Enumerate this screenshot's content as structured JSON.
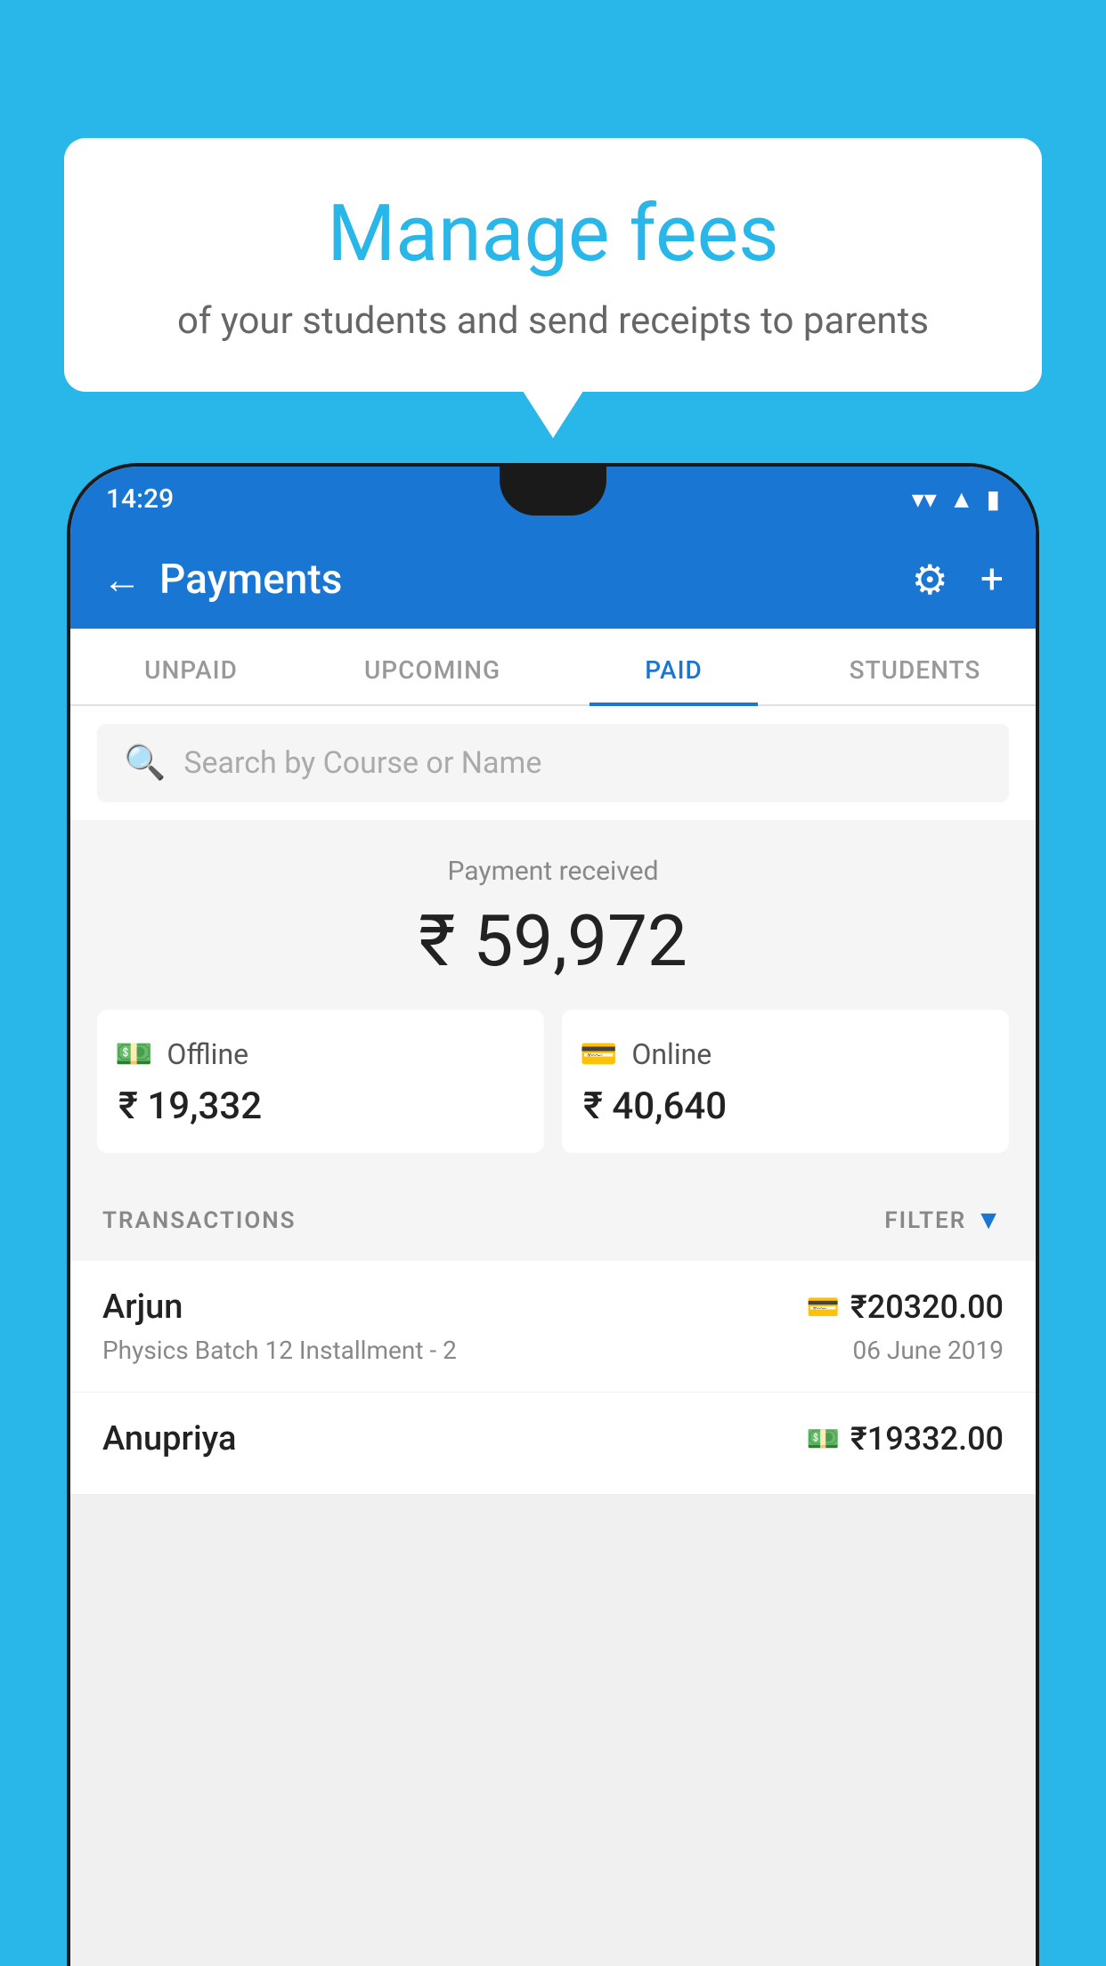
{
  "background_color": "#29B6E8",
  "speech_bubble": {
    "title": "Manage fees",
    "subtitle": "of your students and send receipts to parents"
  },
  "status_bar": {
    "time": "14:29"
  },
  "app_bar": {
    "title": "Payments",
    "back_label": "←",
    "gear_label": "⚙",
    "plus_label": "+"
  },
  "tabs": [
    {
      "label": "UNPAID",
      "active": false
    },
    {
      "label": "UPCOMING",
      "active": false
    },
    {
      "label": "PAID",
      "active": true
    },
    {
      "label": "STUDENTS",
      "active": false
    }
  ],
  "search": {
    "placeholder": "Search by Course or Name"
  },
  "payment_summary": {
    "label": "Payment received",
    "total": "₹ 59,972",
    "offline": {
      "label": "Offline",
      "amount": "₹ 19,332"
    },
    "online": {
      "label": "Online",
      "amount": "₹ 40,640"
    }
  },
  "transactions": {
    "header_label": "TRANSACTIONS",
    "filter_label": "FILTER",
    "rows": [
      {
        "name": "Arjun",
        "description": "Physics Batch 12 Installment - 2",
        "amount": "₹20320.00",
        "date": "06 June 2019",
        "icon_type": "card"
      },
      {
        "name": "Anupriya",
        "description": "",
        "amount": "₹19332.00",
        "date": "",
        "icon_type": "cash"
      }
    ]
  }
}
